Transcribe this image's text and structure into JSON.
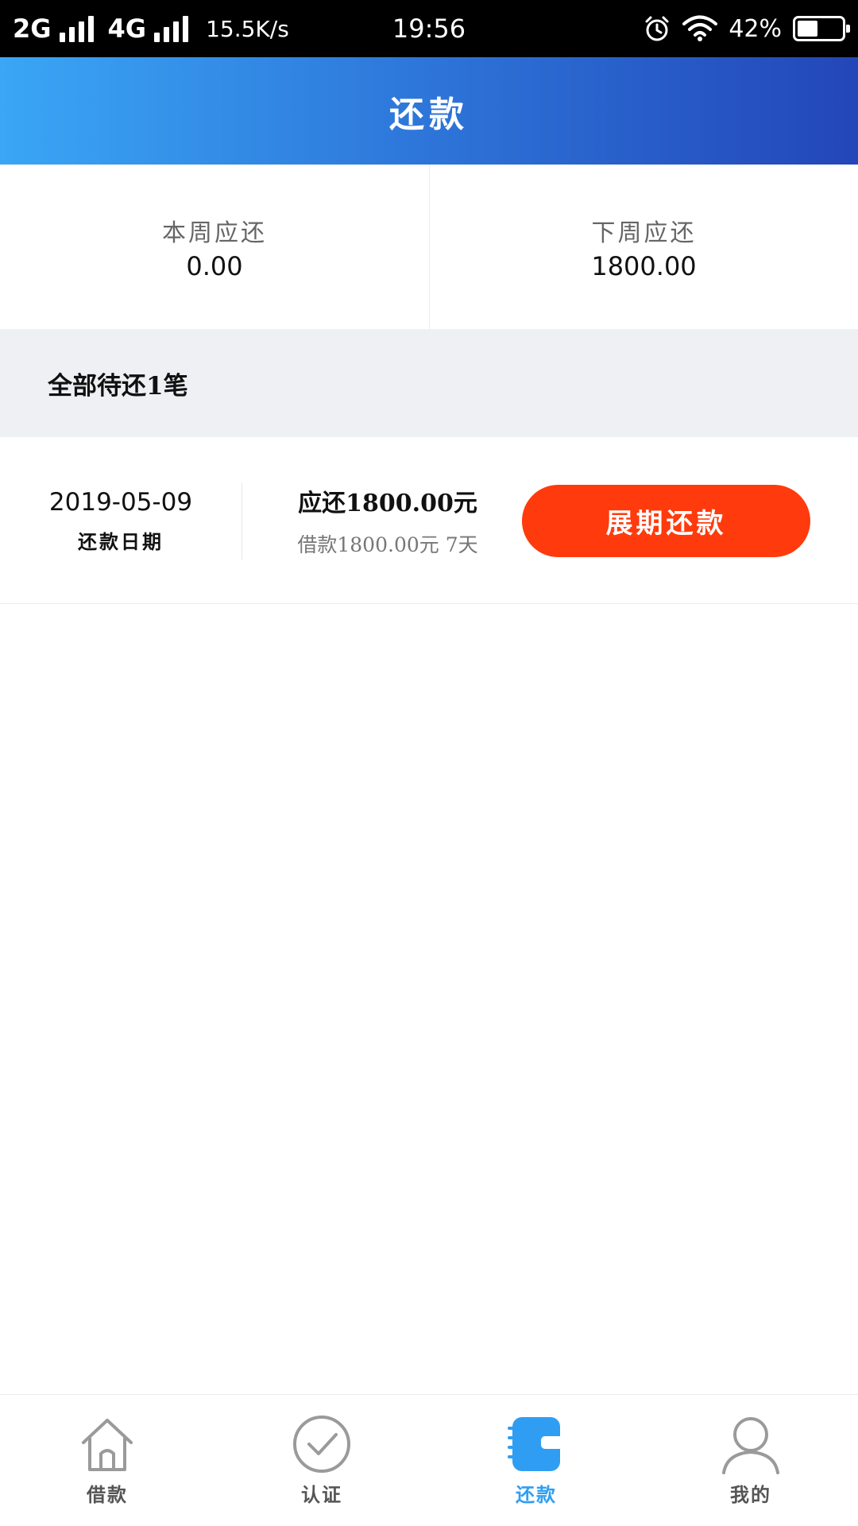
{
  "status_bar": {
    "network1": "2G",
    "network2": "4G",
    "speed": "15.5K/s",
    "time": "19:56",
    "battery": "42%",
    "battery_level": 0.42
  },
  "header": {
    "title": "还款"
  },
  "summary": [
    {
      "label": "本周应还",
      "value": "0.00"
    },
    {
      "label": "下周应还",
      "value": "1800.00"
    }
  ],
  "section": {
    "title": "全部待还1笔"
  },
  "repay_item": {
    "date": "2019-05-09",
    "date_label": "还款日期",
    "due": "应还1800.00元",
    "loan": "借款1800.00元  7天",
    "button_label": "展期还款"
  },
  "tabs": [
    {
      "label": "借款",
      "icon": "home-icon",
      "active": false
    },
    {
      "label": "认证",
      "icon": "check-circle-icon",
      "active": false
    },
    {
      "label": "还款",
      "icon": "wallet-icon",
      "active": true
    },
    {
      "label": "我的",
      "icon": "user-icon",
      "active": false
    }
  ],
  "colors": {
    "accent": "#2f9ef2",
    "button": "#ff3a0c",
    "header_start": "#3aa6f5",
    "header_end": "#2346b8"
  }
}
